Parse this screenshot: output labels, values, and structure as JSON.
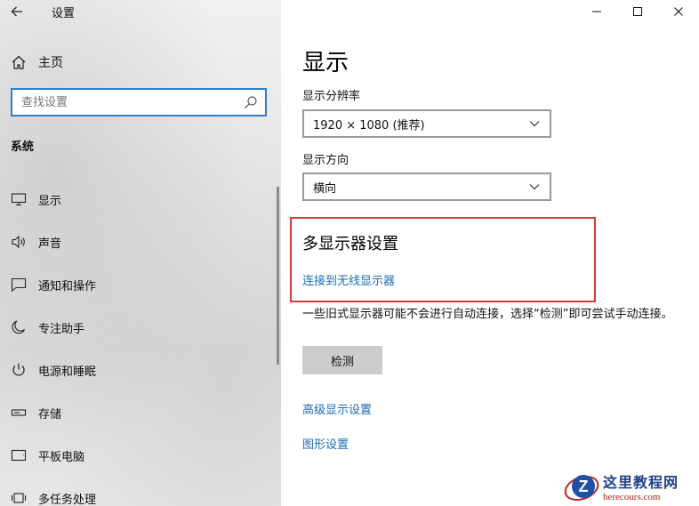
{
  "window": {
    "title": "设置",
    "controls": [
      "minimize-icon",
      "maximize-icon",
      "close-icon"
    ]
  },
  "sidebar": {
    "home_label": "主页",
    "search_placeholder": "查找设置",
    "section_title": "系统",
    "items": [
      {
        "label": "显示",
        "icon": "monitor-icon"
      },
      {
        "label": "声音",
        "icon": "speaker-icon"
      },
      {
        "label": "通知和操作",
        "icon": "notification-icon"
      },
      {
        "label": "专注助手",
        "icon": "moon-icon"
      },
      {
        "label": "电源和睡眠",
        "icon": "power-icon"
      },
      {
        "label": "存储",
        "icon": "storage-icon"
      },
      {
        "label": "平板电脑",
        "icon": "tablet-icon"
      },
      {
        "label": "多任务处理",
        "icon": "multitask-icon"
      }
    ]
  },
  "main": {
    "page_title": "显示",
    "resolution": {
      "label": "显示分辨率",
      "value": "1920 × 1080 (推荐)"
    },
    "orientation": {
      "label": "显示方向",
      "value": "横向"
    },
    "multi_display": {
      "title": "多显示器设置",
      "wireless_link": "连接到无线显示器",
      "description": "一些旧式显示器可能不会进行自动连接，选择“检测”即可尝试手动连接。",
      "detect_button": "检测"
    },
    "advanced_link": "高级显示设置",
    "graphics_link": "图形设置"
  },
  "colors": {
    "accent": "#2b7fd6",
    "link": "#1a6cb6",
    "highlight_box": "#d83b3b"
  },
  "watermark": {
    "name": "这里教程网",
    "url": "herecours.com"
  }
}
